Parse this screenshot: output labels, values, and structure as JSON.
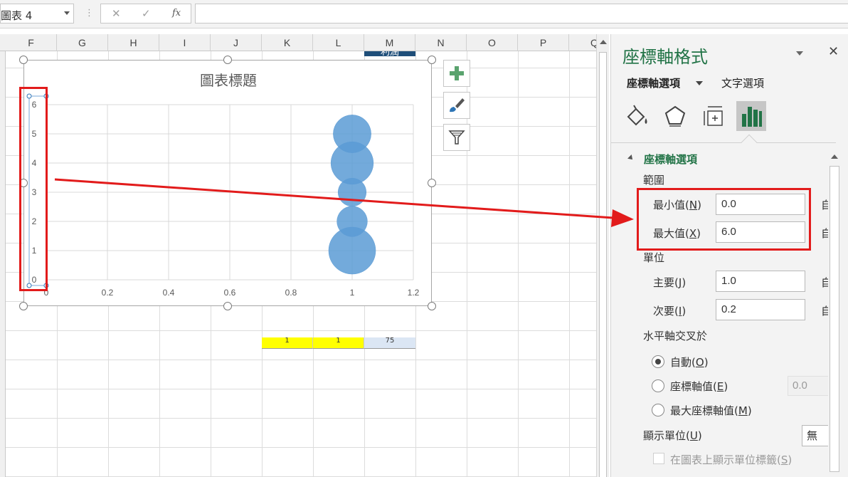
{
  "formula_bar": {
    "name_box": "圖表 4",
    "cancel_glyph": "✕",
    "enter_glyph": "✓",
    "fx_glyph": "fx",
    "formula": ""
  },
  "sheet": {
    "columns": [
      "F",
      "G",
      "H",
      "I",
      "J",
      "K",
      "L",
      "M",
      "N",
      "O",
      "P",
      "Q"
    ],
    "m_header_text": "利潤",
    "yellow_cells": [
      "1",
      "1"
    ],
    "blue_cell": "75"
  },
  "chart_data": {
    "type": "bubble",
    "title": "圖表標題",
    "xlim": [
      0,
      1.2
    ],
    "ylim": [
      0,
      6
    ],
    "x_ticks": [
      0,
      0.2,
      0.4,
      0.6,
      0.8,
      1,
      1.2
    ],
    "y_ticks": [
      0,
      1,
      2,
      3,
      4,
      5,
      6
    ],
    "x_tick_labels": [
      "0",
      "0.2",
      "0.4",
      "0.6",
      "0.8",
      "1",
      "1.2"
    ],
    "y_tick_labels": [
      "0",
      "1",
      "2",
      "3",
      "4",
      "5",
      "6"
    ],
    "grid": true,
    "series": [
      {
        "color": "#5b9bd5",
        "points": [
          {
            "x": 1,
            "y": 1,
            "size": 100
          },
          {
            "x": 1,
            "y": 2,
            "size": 42
          },
          {
            "x": 1,
            "y": 3,
            "size": 36
          },
          {
            "x": 1,
            "y": 4,
            "size": 82
          },
          {
            "x": 1,
            "y": 5,
            "size": 65
          }
        ]
      }
    ]
  },
  "chart_side_buttons": [
    "plus-icon",
    "brush-icon",
    "filter-icon"
  ],
  "panel": {
    "title": "座標軸格式",
    "close_glyph": "✕",
    "tab_axis_options": "座標軸選項",
    "tab_text_options": "文字選項",
    "icon_tabs": [
      "fill-line-icon",
      "effects-icon",
      "size-properties-icon",
      "axis-options-icon"
    ],
    "section_title": "座標軸選項",
    "bounds_label": "範圍",
    "min_label": "最小值",
    "min_key": "N",
    "min_value": "0.0",
    "max_label": "最大值",
    "max_key": "X",
    "max_value": "6.0",
    "units_label": "單位",
    "major_label": "主要",
    "major_key": "J",
    "major_value": "1.0",
    "minor_label": "次要",
    "minor_key": "I",
    "minor_value": "0.2",
    "auto_cut": "自",
    "h_cross_label": "水平軸交叉於",
    "radio_auto": "自動",
    "radio_auto_key": "O",
    "radio_axis_value": "座標軸值",
    "radio_axis_value_key": "E",
    "axis_value_field": "0.0",
    "radio_max": "最大座標軸值",
    "radio_max_key": "M",
    "display_units_label": "顯示單位",
    "display_units_key": "U",
    "display_units_value": "無",
    "show_units_label": "在圖表上顯示單位標籤",
    "show_units_key": "S"
  },
  "annotation": {
    "color": "#e21b1b"
  }
}
